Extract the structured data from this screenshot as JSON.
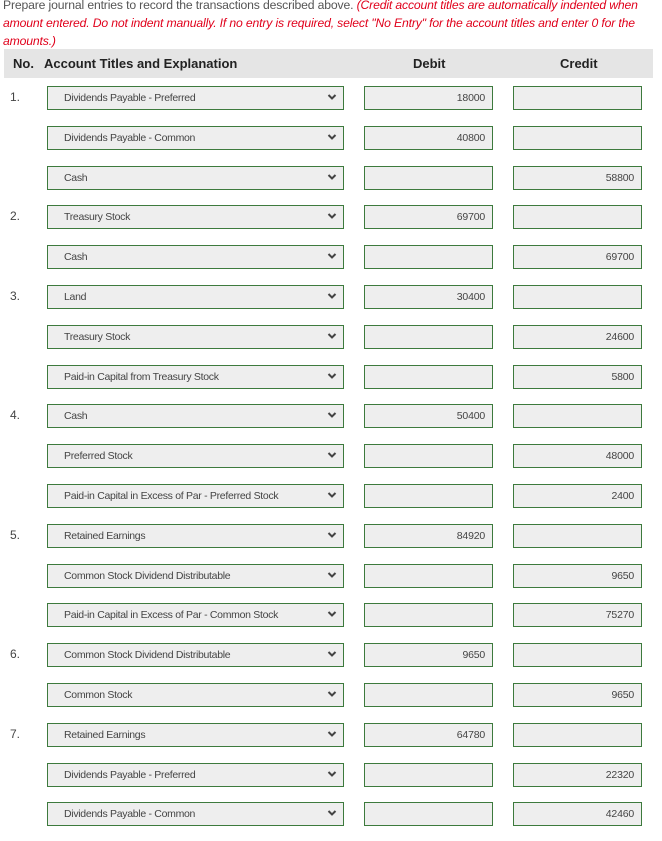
{
  "instructions": {
    "text": "Prepare journal entries to record the transactions described above.",
    "note": "(Credit account titles are automatically indented when amount entered. Do not indent manually. If no entry is required, select \"No Entry\" for the account titles and enter 0 for the amounts.)"
  },
  "table": {
    "headers": {
      "no": "No.",
      "account": "Account Titles and Explanation",
      "debit": "Debit",
      "credit": "Credit"
    },
    "rows": [
      {
        "no": "1.",
        "account": "Dividends Payable - Preferred",
        "debit": "18000",
        "credit": ""
      },
      {
        "no": "",
        "account": "Dividends Payable - Common",
        "debit": "40800",
        "credit": ""
      },
      {
        "no": "",
        "account": "Cash",
        "debit": "",
        "credit": "58800"
      },
      {
        "no": "2.",
        "account": "Treasury Stock",
        "debit": "69700",
        "credit": ""
      },
      {
        "no": "",
        "account": "Cash",
        "debit": "",
        "credit": "69700"
      },
      {
        "no": "3.",
        "account": "Land",
        "debit": "30400",
        "credit": ""
      },
      {
        "no": "",
        "account": "Treasury Stock",
        "debit": "",
        "credit": "24600"
      },
      {
        "no": "",
        "account": "Paid-in Capital from Treasury Stock",
        "debit": "",
        "credit": "5800"
      },
      {
        "no": "4.",
        "account": "Cash",
        "debit": "50400",
        "credit": ""
      },
      {
        "no": "",
        "account": "Preferred Stock",
        "debit": "",
        "credit": "48000"
      },
      {
        "no": "",
        "account": "Paid-in Capital in Excess of Par - Preferred Stock",
        "debit": "",
        "credit": "2400"
      },
      {
        "no": "5.",
        "account": "Retained Earnings",
        "debit": "84920",
        "credit": ""
      },
      {
        "no": "",
        "account": "Common Stock Dividend Distributable",
        "debit": "",
        "credit": "9650"
      },
      {
        "no": "",
        "account": "Paid-in Capital in Excess of Par - Common Stock",
        "debit": "",
        "credit": "75270"
      },
      {
        "no": "6.",
        "account": "Common Stock Dividend Distributable",
        "debit": "9650",
        "credit": ""
      },
      {
        "no": "",
        "account": "Common Stock",
        "debit": "",
        "credit": "9650"
      },
      {
        "no": "7.",
        "account": "Retained Earnings",
        "debit": "64780",
        "credit": ""
      },
      {
        "no": "",
        "account": "Dividends Payable - Preferred",
        "debit": "",
        "credit": "22320"
      },
      {
        "no": "",
        "account": "Dividends Payable - Common",
        "debit": "",
        "credit": "42460"
      }
    ]
  },
  "icons": {
    "dropdown": "chevron-down-icon"
  },
  "colors": {
    "field_border": "#3d7a3d",
    "field_fill": "#eeeeee",
    "header_fill": "#e5e5e5",
    "note_text": "#e0001b"
  }
}
